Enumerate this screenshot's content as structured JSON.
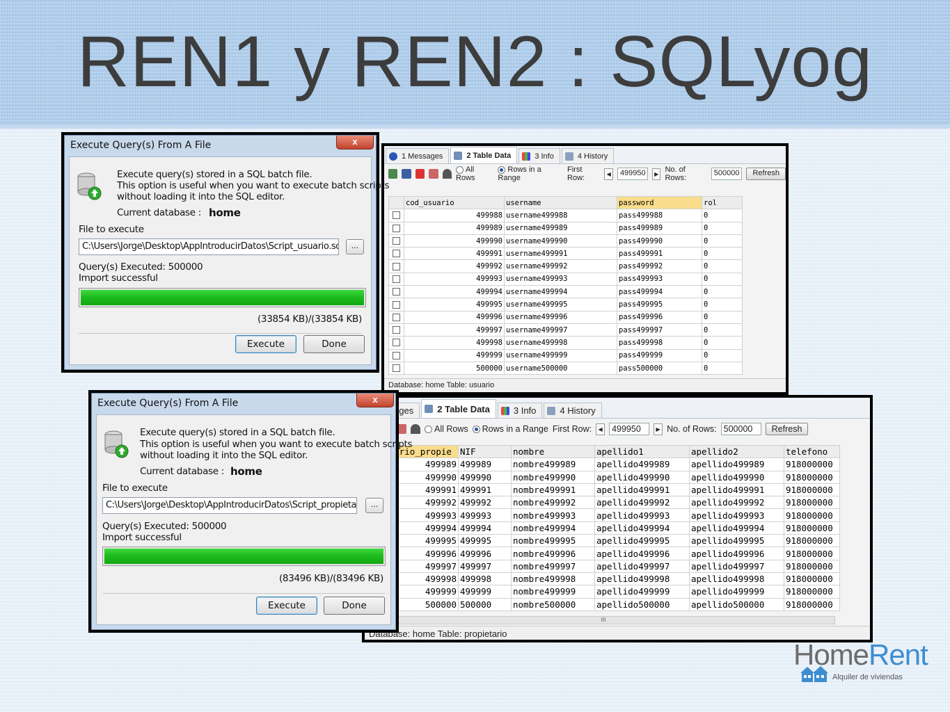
{
  "slide": {
    "title": "REN1 y REN2 : SQLyog"
  },
  "logo": {
    "home": "Home",
    "rent": "Rent",
    "subtitle": "Alquiler de viviendas"
  },
  "colors": {
    "progress": "#1cba1c",
    "selected_header": "#f9dc8c",
    "title_text": "#3d3d3d",
    "logo_blue": "#3d8ed0"
  },
  "dialog1": {
    "title": "Execute Query(s) From A File",
    "close": "x",
    "desc1": "Execute query(s) stored in a SQL batch file.",
    "desc2": "This option is useful when you want to execute batch scripts",
    "desc3": "without loading it into the SQL editor.",
    "db_label": "Current database :",
    "db_value": "home",
    "file_label": "File to execute",
    "file_path": "C:\\Users\\Jorge\\Desktop\\AppIntroducirDatos\\Script_usuario.sql",
    "browse": "...",
    "executed": "Query(s) Executed: 500000",
    "status": "Import successful",
    "progress": 1.0,
    "size": "(33854 KB)/(33854 KB)",
    "execute_btn": "Execute",
    "done_btn": "Done"
  },
  "dialog2": {
    "title": "Execute Query(s) From A File",
    "close": "x",
    "desc1": "Execute query(s) stored in a SQL batch file.",
    "desc2": "This option is useful when you want to execute batch scripts",
    "desc3": "without loading it into the SQL editor.",
    "db_label": "Current database :",
    "db_value": "home",
    "file_label": "File to execute",
    "file_path": "C:\\Users\\Jorge\\Desktop\\AppIntroducirDatos\\Script_propietario",
    "browse": "...",
    "executed": "Query(s) Executed: 500000",
    "status": "Import successful",
    "progress": 1.0,
    "size": "(83496 KB)/(83496 KB)",
    "execute_btn": "Execute",
    "done_btn": "Done"
  },
  "result1": {
    "tabs": [
      "1 Messages",
      "2 Table Data",
      "3 Info",
      "4 History"
    ],
    "all_rows": "All Rows",
    "rows_in_range": "Rows in a Range",
    "first_row_label": "First Row:",
    "first_row": "499950",
    "num_rows_label": "No. of Rows:",
    "num_rows": "500000",
    "refresh": "Refresh",
    "columns": [
      "cod_usuario",
      "username",
      "password",
      "rol"
    ],
    "rows": [
      [
        "499988",
        "username499988",
        "pass499988",
        "0"
      ],
      [
        "499989",
        "username499989",
        "pass499989",
        "0"
      ],
      [
        "499990",
        "username499990",
        "pass499990",
        "0"
      ],
      [
        "499991",
        "username499991",
        "pass499991",
        "0"
      ],
      [
        "499992",
        "username499992",
        "pass499992",
        "0"
      ],
      [
        "499993",
        "username499993",
        "pass499993",
        "0"
      ],
      [
        "499994",
        "username499994",
        "pass499994",
        "0"
      ],
      [
        "499995",
        "username499995",
        "pass499995",
        "0"
      ],
      [
        "499996",
        "username499996",
        "pass499996",
        "0"
      ],
      [
        "499997",
        "username499997",
        "pass499997",
        "0"
      ],
      [
        "499998",
        "username499998",
        "pass499998",
        "0"
      ],
      [
        "499999",
        "username499999",
        "pass499999",
        "0"
      ],
      [
        "500000",
        "username500000",
        "pass500000",
        "0"
      ]
    ],
    "status": "Database: home Table: usuario"
  },
  "result2": {
    "tabs": [
      "Messages",
      "2 Table Data",
      "3 Info",
      "4 History"
    ],
    "all_rows": "All Rows",
    "rows_in_range": "Rows in a Range",
    "first_row_label": "First Row:",
    "first_row": "499950",
    "num_rows_label": "No. of Rows:",
    "num_rows": "500000",
    "refresh": "Refresh",
    "columns": [
      "od_usuario_propie",
      "NIF",
      "nombre",
      "apellido1",
      "apellido2",
      "telefono"
    ],
    "rows": [
      [
        "499989",
        "499989",
        "nombre499989",
        "apellido499989",
        "apellido499989",
        "918000000"
      ],
      [
        "499990",
        "499990",
        "nombre499990",
        "apellido499990",
        "apellido499990",
        "918000000"
      ],
      [
        "499991",
        "499991",
        "nombre499991",
        "apellido499991",
        "apellido499991",
        "918000000"
      ],
      [
        "499992",
        "499992",
        "nombre499992",
        "apellido499992",
        "apellido499992",
        "918000000"
      ],
      [
        "499993",
        "499993",
        "nombre499993",
        "apellido499993",
        "apellido499993",
        "918000000"
      ],
      [
        "499994",
        "499994",
        "nombre499994",
        "apellido499994",
        "apellido499994",
        "918000000"
      ],
      [
        "499995",
        "499995",
        "nombre499995",
        "apellido499995",
        "apellido499995",
        "918000000"
      ],
      [
        "499996",
        "499996",
        "nombre499996",
        "apellido499996",
        "apellido499996",
        "918000000"
      ],
      [
        "499997",
        "499997",
        "nombre499997",
        "apellido499997",
        "apellido499997",
        "918000000"
      ],
      [
        "499998",
        "499998",
        "nombre499998",
        "apellido499998",
        "apellido499998",
        "918000000"
      ],
      [
        "499999",
        "499999",
        "nombre499999",
        "apellido499999",
        "apellido499999",
        "918000000"
      ],
      [
        "500000",
        "500000",
        "nombre500000",
        "apellido500000",
        "apellido500000",
        "918000000"
      ]
    ],
    "scroll_mark": "III",
    "status": "Database: home Table: propietario"
  }
}
